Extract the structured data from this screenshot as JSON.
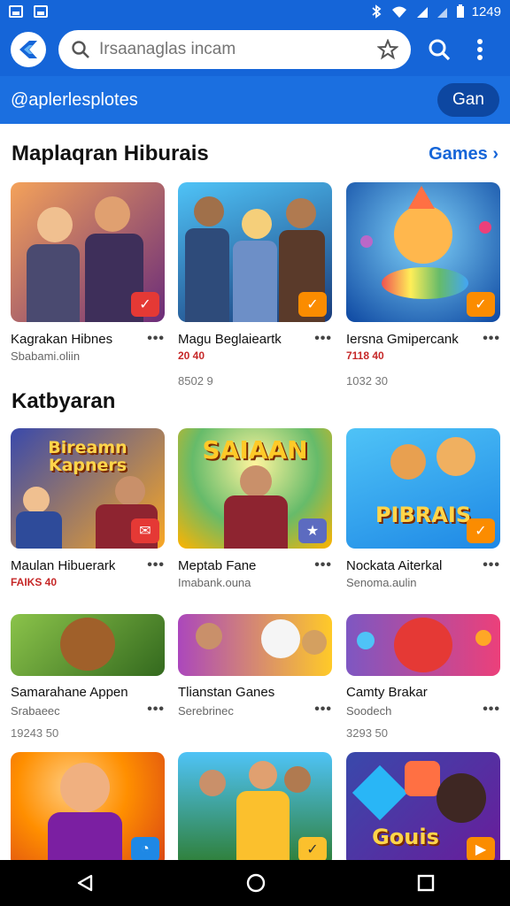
{
  "status_bar": {
    "time": "1249"
  },
  "search": {
    "placeholder": "Irsaanaglas incam"
  },
  "account": {
    "handle": "@aplerlesplotes",
    "button_label": "Gan"
  },
  "section1": {
    "title": "Maplaqran Hiburais",
    "link": "Games",
    "cards": [
      {
        "name": "Kagrakan Hibnes",
        "sub": "Sbabami.oliin",
        "thumb_colors": [
          "#f4a25a",
          "#6a2c7a"
        ],
        "badge_color": "#e53935"
      },
      {
        "name": "Magu Beglaieartk",
        "sub": "",
        "rating": "20 40",
        "price": "8502 9",
        "thumb_colors": [
          "#4fc3f7",
          "#1a3b7a"
        ],
        "badge_color": "#fb8c00"
      },
      {
        "name": "Iersna Gmipercank",
        "sub": "",
        "rating": "7118 40",
        "price": "1032 30",
        "thumb_colors": [
          "#29b6f6",
          "#0d47a1"
        ],
        "badge_color": "#fb8c00"
      }
    ]
  },
  "section2": {
    "title": "Katbyaran",
    "cards": [
      {
        "name": "Maulan Hibuerark",
        "sub": "",
        "rating": "FAIKS 40",
        "thumb_word": "Bireamn Kapners",
        "thumb_colors": [
          "#3949ab",
          "#f9a825"
        ],
        "badge_color": "#e53935"
      },
      {
        "name": "Meptab Fane",
        "sub": "Imabank.ouna",
        "thumb_word": "SAIAAN",
        "thumb_colors": [
          "#66bb6a",
          "#ffb300"
        ],
        "badge_color": "#5c6bc0"
      },
      {
        "name": "Nockata Aiterkal",
        "sub": "Senoma.aulin",
        "thumb_word": "PIBRAIS",
        "thumb_colors": [
          "#4fc3f7",
          "#1e88e5"
        ],
        "badge_color": "#fb8c00"
      }
    ]
  },
  "section3": {
    "cards": [
      {
        "name": "Samarahane Appen",
        "sub": "Srabaeec",
        "price": "19243 50",
        "thumb_colors": [
          "#8bc34a",
          "#33691e"
        ]
      },
      {
        "name": "Tlianstan Ganes",
        "sub": "Serebrinec",
        "thumb_colors": [
          "#ab47bc",
          "#ffca28"
        ]
      },
      {
        "name": "Camty Brakar",
        "sub": "Soodech",
        "price": "3293 50",
        "thumb_colors": [
          "#ec407a",
          "#7e57c2"
        ]
      }
    ]
  },
  "section4": {
    "cards": [
      {
        "thumb_colors": [
          "#ff8f00",
          "#d84315"
        ],
        "badge_color": "#1e88e5"
      },
      {
        "thumb_colors": [
          "#4fc3f7",
          "#2e7d32"
        ],
        "badge_color": "#fbc02d"
      },
      {
        "thumb_word": "Gouis",
        "thumb_colors": [
          "#3949ab",
          "#6a1b9a"
        ],
        "badge_color": "#fb8c00"
      }
    ]
  }
}
